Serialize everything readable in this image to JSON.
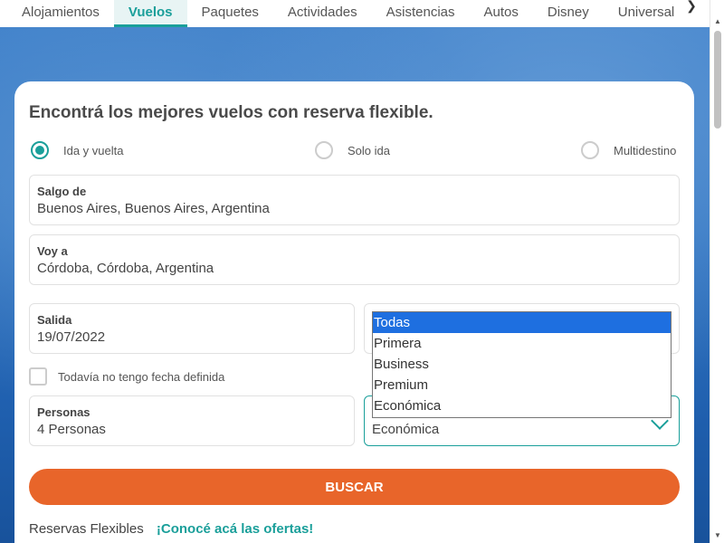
{
  "nav": {
    "tabs": [
      {
        "label": "Alojamientos"
      },
      {
        "label": "Vuelos"
      },
      {
        "label": "Paquetes"
      },
      {
        "label": "Actividades"
      },
      {
        "label": "Asistencias"
      },
      {
        "label": "Autos"
      },
      {
        "label": "Disney"
      },
      {
        "label": "Universal"
      }
    ],
    "active": "Vuelos",
    "arrow_icon": "chevron-right-icon"
  },
  "form": {
    "title": "Encontrá los mejores vuelos con reserva flexible.",
    "trip_types": [
      {
        "label": "Ida y vuelta",
        "checked": true
      },
      {
        "label": "Solo ida",
        "checked": false
      },
      {
        "label": "Multidestino",
        "checked": false
      }
    ],
    "origin": {
      "label": "Salgo de",
      "value": "Buenos Aires, Buenos Aires, Argentina"
    },
    "destination": {
      "label": "Voy a",
      "value": "Córdoba, Córdoba, Argentina"
    },
    "departure": {
      "label": "Salida",
      "value": "19/07/2022"
    },
    "no_date_label": "Todavía no tengo fecha definida",
    "passengers": {
      "label": "Personas",
      "value": "4 Personas"
    },
    "cabin_class": {
      "value": "Económica",
      "options": [
        "Todas",
        "Primera",
        "Business",
        "Premium",
        "Económica"
      ],
      "highlighted": "Todas"
    },
    "search_button": "BUSCAR"
  },
  "footer": {
    "text": "Reservas Flexibles",
    "link": "¡Conocé acá las ofertas!"
  },
  "colors": {
    "accent": "#1a9f9a",
    "button": "#e8652a",
    "highlight": "#1e6fe0"
  }
}
